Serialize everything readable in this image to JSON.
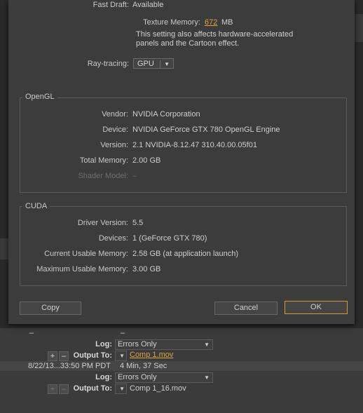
{
  "dialog": {
    "fast_draft_label": "Fast Draft:",
    "fast_draft_value": "Available",
    "texture_memory_label": "Texture Memory:",
    "texture_memory_value": "672",
    "texture_memory_unit": "MB",
    "note_line1": "This setting also affects hardware-accelerated",
    "note_line2": "panels and the Cartoon effect.",
    "ray_tracing_label": "Ray-tracing:",
    "ray_tracing_value": "GPU",
    "opengl": {
      "title": "OpenGL",
      "rows": [
        {
          "label": "Vendor:",
          "value": "NVIDIA Corporation"
        },
        {
          "label": "Device:",
          "value": "NVIDIA GeForce GTX 780 OpenGL Engine"
        },
        {
          "label": "Version:",
          "value": "2.1 NVIDIA-8.12.47 310.40.00.05f01"
        },
        {
          "label": "Total Memory:",
          "value": "2.00 GB"
        },
        {
          "label": "Shader Model:",
          "value": "–"
        }
      ]
    },
    "cuda": {
      "title": "CUDA",
      "rows": [
        {
          "label": "Driver Version:",
          "value": "5.5"
        },
        {
          "label": "Devices:",
          "value": "1 (GeForce GTX 780)"
        },
        {
          "label": "Current Usable Memory:",
          "value": "2.58 GB (at application launch)"
        },
        {
          "label": "Maximum Usable Memory:",
          "value": "3.00 GB"
        }
      ]
    },
    "copy_label": "Copy",
    "cancel_label": "Cancel",
    "ok_label": "OK"
  },
  "render_queue": {
    "dash1": "–",
    "dash2": "–",
    "log_label": "Log:",
    "log_value_1": "Errors Only",
    "output_to_label": "Output To:",
    "output_file_1": "Comp 1.mov",
    "item2_time": "8/22/13...33:50 PM PDT",
    "item2_duration": "4 Min, 37 Sec",
    "log_value_2": "Errors Only",
    "output_file_2": "Comp 1_16.mov"
  },
  "colors": {
    "accent": "#e0a43a",
    "dialog_bg": "#3c3c3c"
  }
}
